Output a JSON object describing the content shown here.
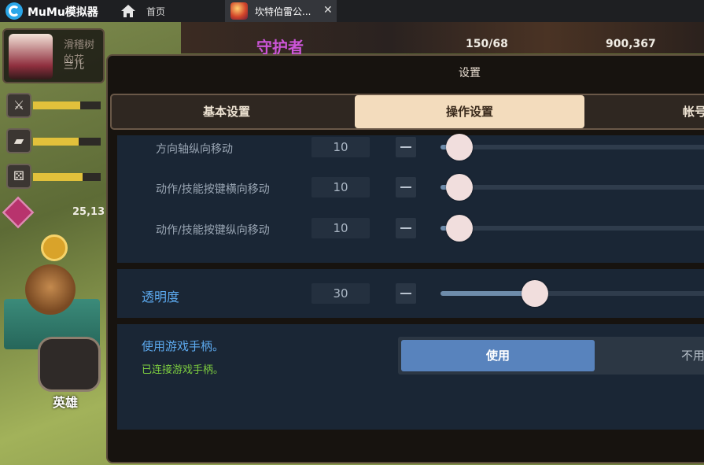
{
  "titlebar": {
    "app_name": "MuMu模拟器",
    "home_label": "首页",
    "tab_label": "坎特伯雷公...",
    "close_glyph": "✕"
  },
  "game": {
    "profile_subtitle": "滑稽树的花",
    "profile_name": "兰儿",
    "gem_count": "25,13",
    "energy": "150/68",
    "gold": "900,367",
    "banner_text": "守护者",
    "hero_label": "英雄",
    "stat_bars": [
      0.7,
      0.67,
      0.73
    ]
  },
  "settings": {
    "title": "设置",
    "tabs": {
      "basic": "基本设置",
      "operation": "操作设置",
      "account": "帐号"
    },
    "sliders": [
      {
        "label": "方向轴纵向移动",
        "value": "10",
        "level": 0.07
      },
      {
        "label": "动作/技能按键横向移动",
        "value": "10",
        "level": 0.07
      },
      {
        "label": "动作/技能按键纵向移动",
        "value": "10",
        "level": 0.07
      }
    ],
    "opacity": {
      "label": "透明度",
      "value": "30",
      "level": 0.3
    },
    "gamepad": {
      "label": "使用游戏手柄。",
      "status": "已连接游戏手柄。",
      "option_on": "使用",
      "option_off": "不用"
    }
  },
  "colors": {
    "accent_blue": "#5ca9ee",
    "toggle_active": "#5883bd",
    "connected_green": "#7ecf3f",
    "active_tab": "#f3dcbd"
  }
}
